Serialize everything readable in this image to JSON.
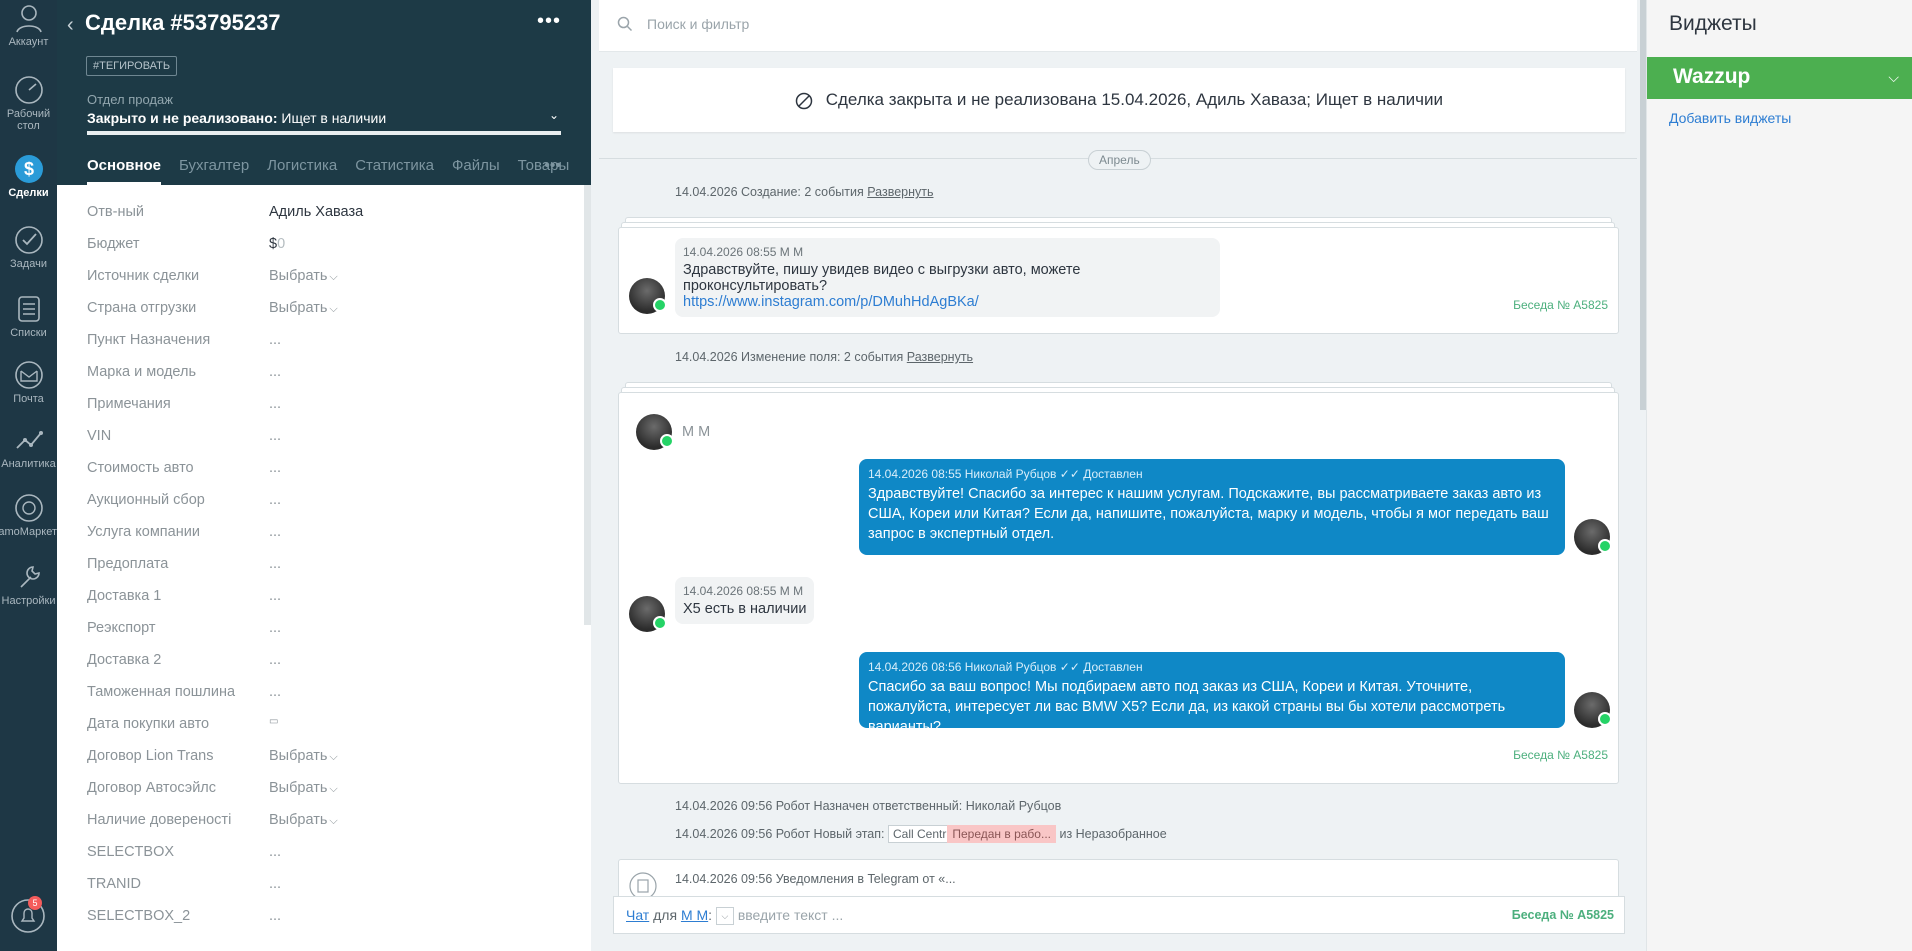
{
  "nav": {
    "items": [
      {
        "label": "Аккаунт",
        "icon": "account-icon"
      },
      {
        "label": "Рабочий стол",
        "line1": "Рабочий",
        "line2": "стол",
        "icon": "dashboard-icon"
      },
      {
        "label": "Сделки",
        "icon": "deals-icon",
        "active": true
      },
      {
        "label": "Задачи",
        "icon": "tasks-icon"
      },
      {
        "label": "Списки",
        "icon": "lists-icon"
      },
      {
        "label": "Почта",
        "icon": "mail-icon"
      },
      {
        "label": "Аналитика",
        "icon": "analytics-icon"
      },
      {
        "label": "amoМаркет",
        "icon": "market-icon"
      },
      {
        "label": "Настройки",
        "icon": "settings-icon"
      }
    ],
    "notifications_count": "5"
  },
  "card": {
    "title": "Сделка #53795237",
    "tag_button": "#ТЕГИРОВАТЬ",
    "pipeline": "Отдел продаж",
    "status_bold": "Закрыто и не реализовано:",
    "status_reason": "Ищет в наличии",
    "tabs": [
      "Основное",
      "Бухгалтерия",
      "Логистика",
      "Статистика",
      "Файлы",
      "Товары"
    ],
    "tabs_display": [
      "Основное",
      "Бухгалтер",
      "Логистика",
      "Статистика",
      "Файлы",
      "Товары"
    ],
    "fields": [
      {
        "label": "Отв-ный",
        "value": "Адиль Хаваза"
      },
      {
        "label": "Бюджет",
        "currency": "$",
        "value": "0"
      },
      {
        "label": "Источник сделки",
        "value": "Выбрать"
      },
      {
        "label": "Страна отгрузки",
        "value": "Выбрать"
      },
      {
        "label": "Пункт Назначения",
        "value": "..."
      },
      {
        "label": "Марка и модель",
        "value": "..."
      },
      {
        "label": "Примечания",
        "value": "..."
      },
      {
        "label": "VIN",
        "value": "..."
      },
      {
        "label": "Стоимость авто",
        "value": "..."
      },
      {
        "label": "Аукционный сбор",
        "value": "..."
      },
      {
        "label": "Услуга компании",
        "value": "..."
      },
      {
        "label": "Предоплата",
        "value": "..."
      },
      {
        "label": "Доставка 1",
        "value": "..."
      },
      {
        "label": "Реэкспорт",
        "value": "..."
      },
      {
        "label": "Доставка 2",
        "value": "..."
      },
      {
        "label": "Таможенная пошлина",
        "value": "..."
      },
      {
        "label": "Дата покупки авто",
        "value": ""
      },
      {
        "label": "Договор Lion Trans",
        "value": "Выбрать"
      },
      {
        "label": "Договор Автосэйлс",
        "value": "Выбрать"
      },
      {
        "label": "Наличие довереності",
        "value": "Выбрать"
      },
      {
        "label": "SELECTBOX",
        "value": "..."
      },
      {
        "label": "TRANID",
        "value": "..."
      },
      {
        "label": "SELECTBOX_2",
        "value": "..."
      }
    ]
  },
  "feed": {
    "search_placeholder": "Поиск и фильтр",
    "closed_banner": "Сделка закрыта и не реализована 15.04.2026, Адиль Хаваза; Ищет в наличии",
    "month": "Апрель",
    "note1": {
      "text": "14.04.2026 Создание: 2 события",
      "link": "Развернуть"
    },
    "msg1": {
      "meta": "14.04.2026 08:55 М М",
      "text": "Здравствуйте, пишу увидев видео с выгрузки авто, можете проконсультировать?",
      "link": "https://www.instagram.com/p/DMuhHdAgBKa/",
      "conversation": "Беседа № A5825"
    },
    "note2": {
      "text": "14.04.2026 Изменение поля: 2 события",
      "link": "Развернуть"
    },
    "chat_block": {
      "contact": "М М",
      "out1": {
        "meta": "14.04.2026 08:55 Николай Рубцов",
        "status": "Доставлен",
        "text": "Здравствуйте! Спасибо за интерес к нашим услугам. Подскажите, вы рассматриваете заказ авто из США, Кореи или Китая? Если да, напишите, пожалуйста, марку и модель, чтобы я мог передать ваш запрос в экспертный отдел."
      },
      "in1": {
        "meta": "14.04.2026 08:55 М М",
        "text": "X5 есть в наличии"
      },
      "out2": {
        "meta": "14.04.2026 08:56 Николай Рубцов",
        "status": "Доставлен",
        "text": "Спасибо за ваш вопрос! Мы подбираем авто под заказ из США, Кореи и Китая. Уточните, пожалуйста, интересует ли вас BMW X5? Если да, из какой страны вы бы хотели рассмотреть варианты?"
      },
      "conversation": "Беседа № A5825"
    },
    "robot_note1": "14.04.2026 09:56 Робот Назначен ответственный: Николай Рубцов",
    "robot_note2": {
      "prefix": "14.04.2026 09:56 Робот Новый этап:",
      "stage_from_chip": "Call Centr",
      "stage_to_chip": "Передан в рабо...",
      "suffix": "из Неразобранное"
    },
    "telegram_note": "14.04.2026 09:56 Уведомления в Telegram от «...",
    "chat_bar": {
      "chat": "Чат",
      "for": "для",
      "contact": "М М",
      "placeholder": "введите текст ...",
      "conversation": "Беседа № A5825"
    }
  },
  "widgets": {
    "title": "Виджеты",
    "wazzup": "Wazzup",
    "add": "Добавить виджеты"
  },
  "colors": {
    "nav_bg": "#1e3745",
    "card_head_bg": "#1d3a46",
    "outgoing_bubble": "#0f88c6",
    "wazzup_green": "#4caf50",
    "conversation_green": "#4caf7d"
  }
}
